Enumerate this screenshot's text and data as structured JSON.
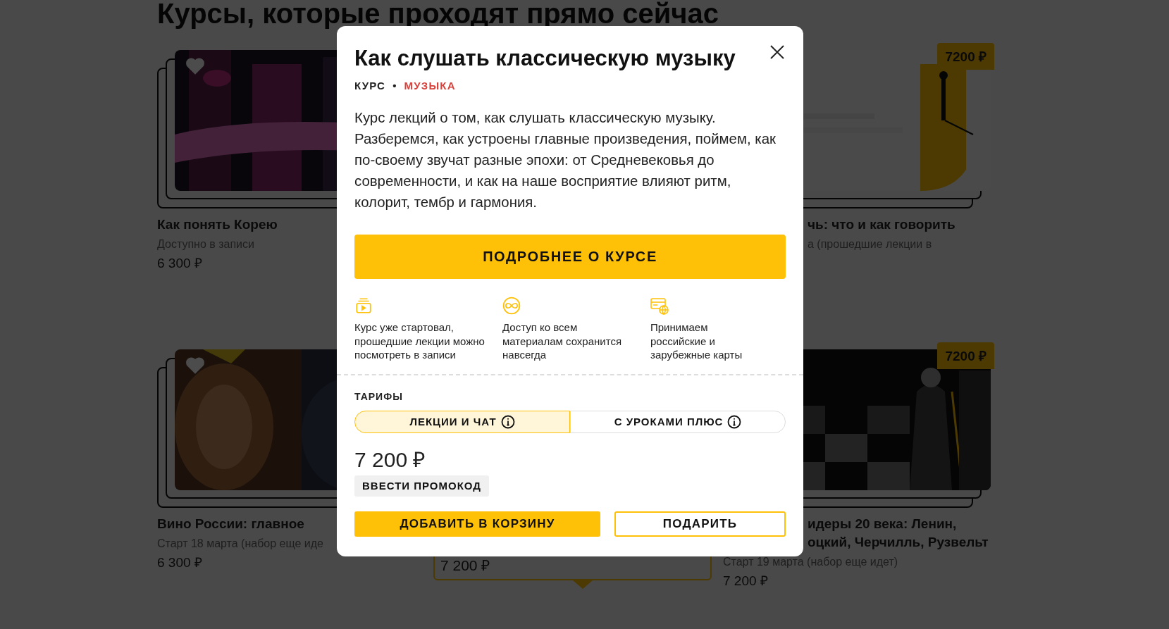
{
  "page": {
    "heading": "Курсы, которые проходят прямо сейчас"
  },
  "left_column": [
    {
      "title_lines": [
        "Как понять Корею"
      ],
      "status": "Доступно в записи",
      "price": "6 300 ₽"
    },
    {
      "title_lines": [
        "Вино России: главное"
      ],
      "status": "Старт 18 марта (набор еще иде",
      "price": "6 300 ₽"
    }
  ],
  "center_column": [
    {
      "price": "7 200 ₽"
    }
  ],
  "right_column": [
    {
      "badge": "7200 ₽",
      "title_lines": [
        "чь: что и как говорить"
      ],
      "status": "а (прошедшие лекции в"
    },
    {
      "badge": "7200 ₽",
      "title_lines": [
        "идеры 20 века: Ленин,",
        "оцкий, Черчилль, Рузвельт"
      ],
      "status": "Старт 19 марта (набор еще идет)",
      "price": "7 200 ₽"
    }
  ],
  "modal": {
    "title": "Как слушать классическую музыку",
    "type": "КУРС",
    "separator": "•",
    "category": "МУЗЫКА",
    "description": "Курс лекций о том, как слушать классическую музыку. Разберемся, как устроены главные произведения, поймем, как по-своему звучат разные эпохи: от Средневековья до современности, и как на наше восприятие влияют ритм, колорит, тембр и гармония.",
    "details_button": "ПОДРОБНЕЕ О КУРСЕ",
    "features": [
      {
        "kind": "video",
        "text": "Курс уже стартовал, прошедшие лекции можно посмотреть в записи"
      },
      {
        "kind": "infinity",
        "text": "Доступ ко всем материалам сохранится навсегда"
      },
      {
        "kind": "card",
        "text": "Принимаем российские и зарубежные карты"
      }
    ],
    "tariffs_label": "ТАРИФЫ",
    "tariffs": [
      {
        "label": "ЛЕКЦИИ И ЧАТ",
        "selected": true
      },
      {
        "label": "С УРОКАМИ ПЛЮС",
        "selected": false
      }
    ],
    "price": "7 200 ₽",
    "promo_button": "ВВЕСТИ ПРОМОКОД",
    "cart_button": "ДОБАВИТЬ В КОРЗИНУ",
    "gift_button": "ПОДАРИТЬ"
  }
}
